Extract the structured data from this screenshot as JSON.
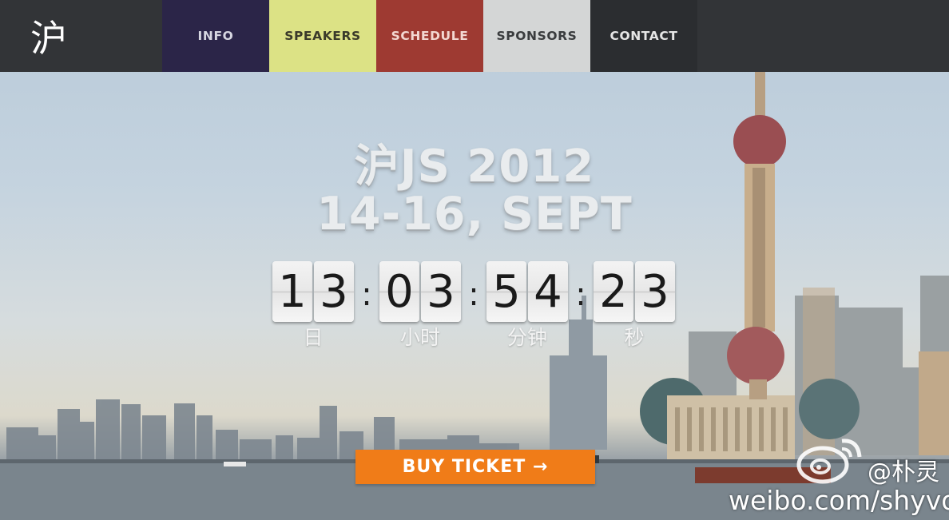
{
  "nav": {
    "logo": "沪",
    "items": [
      {
        "label": "INFO",
        "color": "#2b2548"
      },
      {
        "label": "SPEAKERS",
        "color": "#dce285"
      },
      {
        "label": "SCHEDULE",
        "color": "#9e3a32"
      },
      {
        "label": "SPONSORS",
        "color": "#d4d6d6"
      },
      {
        "label": "CONTACT",
        "color": "#2b2d30"
      }
    ]
  },
  "hero": {
    "title": "沪JS 2012",
    "dates": "14-16, SEPT"
  },
  "countdown": {
    "days": [
      "1",
      "3"
    ],
    "hours": [
      "0",
      "3"
    ],
    "minutes": [
      "5",
      "4"
    ],
    "seconds": [
      "2",
      "3"
    ],
    "separator": ":",
    "labels": {
      "days": "日",
      "hours": "小时",
      "minutes": "分钟",
      "seconds": "秒"
    }
  },
  "cta": {
    "buy_label": "BUY TICKET →",
    "color": "#f07c18"
  },
  "watermark": {
    "icon": "weibo-icon",
    "user": "@朴灵",
    "url": "weibo.com/shyvo"
  }
}
